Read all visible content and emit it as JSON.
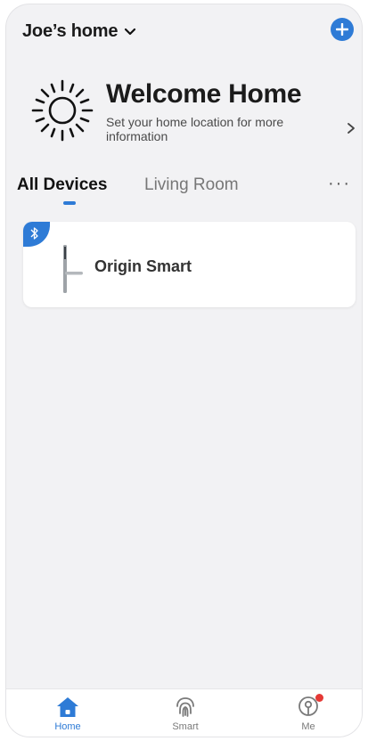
{
  "header": {
    "home_name": "Joe’s  home",
    "colors": {
      "accent": "#2e7bd6",
      "background": "#f2f2f4"
    }
  },
  "welcome": {
    "title": "Welcome Home",
    "subtitle": "Set your home location for more information",
    "icon": "sun-icon"
  },
  "tabs": [
    {
      "label": "All Devices",
      "active": true
    },
    {
      "label": "Living Room",
      "active": false
    }
  ],
  "devices": [
    {
      "name": "Origin Smart",
      "connection": "bluetooth-icon",
      "image": "smart-lock-icon"
    }
  ],
  "bottom_nav": [
    {
      "label": "Home",
      "icon": "home-icon",
      "active": true
    },
    {
      "label": "Smart",
      "icon": "fingerprint-icon",
      "active": false
    },
    {
      "label": "Me",
      "icon": "profile-icon",
      "active": false,
      "notification_dot": true
    }
  ]
}
